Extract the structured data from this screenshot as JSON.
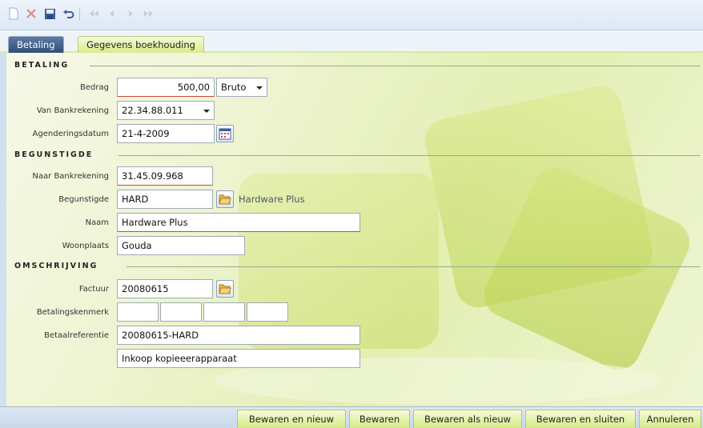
{
  "toolbar": {
    "icons": [
      "new-icon",
      "delete-icon",
      "save-icon",
      "undo-icon",
      "first-icon",
      "previous-icon",
      "next-icon",
      "last-icon"
    ]
  },
  "tabs": [
    {
      "label": "Betaling",
      "active": true
    },
    {
      "label": "Gegevens boekhouding",
      "active": false
    }
  ],
  "sections": {
    "betaling": "BETALING",
    "begunstigde": "BEGUNSTIGDE",
    "omschrijving": "OMSCHRIJVING"
  },
  "form": {
    "bedrag": {
      "label": "Bedrag",
      "value": "500,00",
      "type_value": "Bruto"
    },
    "van_bankrekening": {
      "label": "Van Bankrekening",
      "value": "22.34.88.011"
    },
    "agenderingsdatum": {
      "label": "Agenderingsdatum",
      "value": "21-4-2009"
    },
    "naar_bankrekening": {
      "label": "Naar Bankrekening",
      "value": "31.45.09.968"
    },
    "begunstigde": {
      "label": "Begunstigde",
      "value": "HARD",
      "display_name": "Hardware Plus"
    },
    "naam": {
      "label": "Naam",
      "value": "Hardware Plus"
    },
    "woonplaats": {
      "label": "Woonplaats",
      "value": "Gouda"
    },
    "factuur": {
      "label": "Factuur",
      "value": "20080615"
    },
    "betalingskenmerk": {
      "label": "Betalingskenmerk",
      "values": [
        "",
        "",
        "",
        ""
      ]
    },
    "betaalreferentie": {
      "label": "Betaalreferentie",
      "value": "20080615-HARD"
    },
    "omschrijving": {
      "value": "Inkoop kopieeerapparaat"
    }
  },
  "buttons": {
    "bewaren_nieuw": "Bewaren en nieuw",
    "bewaren": "Bewaren",
    "bewaren_als_nieuw": "Bewaren als nieuw",
    "bewaren_sluiten": "Bewaren en sluiten",
    "annuleren": "Annuleren"
  },
  "colors": {
    "accent_tab": "#2f4e78",
    "content_bg": "#eef4d2",
    "button_bg": "#d6ea86",
    "required_border": "#d2463e"
  }
}
